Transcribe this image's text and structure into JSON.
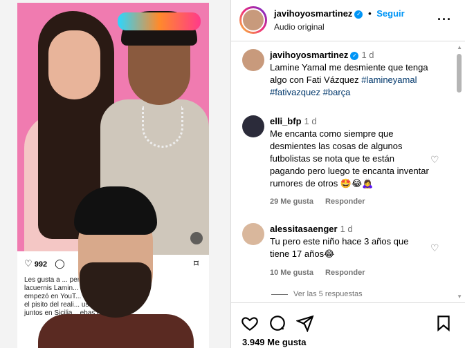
{
  "post_media": {
    "actions": {
      "likes_count": "992",
      "comment_icon": "comment-icon"
    },
    "caption_lines": [
      "Les gusta a ... personas",
      "lacuernis Lamin... Vázquez, (que",
      "empezó en YouT... después estuvo en",
      "el pisito del reali... usado unos días",
      "juntos en Sicilia... ebas en el video"
    ]
  },
  "header": {
    "username": "javihoyosmartinez",
    "follow_label": "Seguir",
    "separator": "•",
    "subtitle": "Audio original",
    "more_icon": "···"
  },
  "comments": [
    {
      "username": "javihoyosmartinez",
      "time": "1 d",
      "text_parts": [
        "Lamine Yamal me desmiente que tenga algo con Fati Vázquez "
      ],
      "hashtags": [
        "#lamineyamal",
        "#fativazquez",
        "#barça"
      ]
    },
    {
      "username": "elli_bfp",
      "time": "1 d",
      "text": "Me encanta como siempre que desmientes las cosas de algunos futbolistas se nota que te están pagando pero luego te encanta inventar rumores de otros 🤩😂🙇‍♀️",
      "likes": "29 Me gusta",
      "reply": "Responder"
    },
    {
      "username": "alessitasaenger",
      "time": "1 d",
      "text": "Tu pero este niño hace 3 años que tiene 17 años😂",
      "likes": "10 Me gusta",
      "reply": "Responder",
      "view_replies": "Ver las 5 respuestas"
    }
  ],
  "footer": {
    "likes_total": "3.949 Me gusta"
  },
  "colors": {
    "accent": "#0095f6",
    "border": "#dbdbdb",
    "muted": "#737373",
    "hashtag": "#00376b"
  }
}
